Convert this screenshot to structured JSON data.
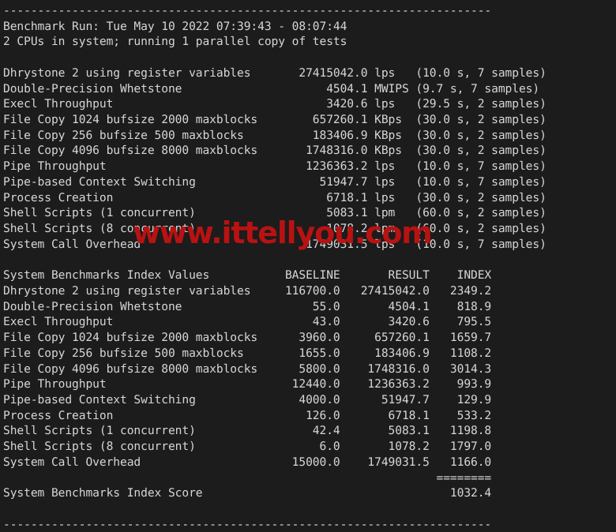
{
  "terminal": {
    "background_color": "#1c1c1c",
    "text_color": "#d6d6d6",
    "separator_line": "-----------------------------------------------------------------------",
    "header": {
      "benchmark_run": "Benchmark Run: Tue May 10 2022 07:39:43 - 08:07:44",
      "cpu_info": "2 CPUs in system; running 1 parallel copy of tests"
    },
    "results": {
      "rows": [
        {
          "name": "Dhrystone 2 using register variables",
          "value": "27415042.0",
          "unit": "lps",
          "detail": "(10.0 s, 7 samples)"
        },
        {
          "name": "Double-Precision Whetstone",
          "value": "4504.1",
          "unit": "MWIPS",
          "detail": "(9.7 s, 7 samples)"
        },
        {
          "name": "Execl Throughput",
          "value": "3420.6",
          "unit": "lps",
          "detail": "(29.5 s, 2 samples)"
        },
        {
          "name": "File Copy 1024 bufsize 2000 maxblocks",
          "value": "657260.1",
          "unit": "KBps",
          "detail": "(30.0 s, 2 samples)"
        },
        {
          "name": "File Copy 256 bufsize 500 maxblocks",
          "value": "183406.9",
          "unit": "KBps",
          "detail": "(30.0 s, 2 samples)"
        },
        {
          "name": "File Copy 4096 bufsize 8000 maxblocks",
          "value": "1748316.0",
          "unit": "KBps",
          "detail": "(30.0 s, 2 samples)"
        },
        {
          "name": "Pipe Throughput",
          "value": "1236363.2",
          "unit": "lps",
          "detail": "(10.0 s, 7 samples)"
        },
        {
          "name": "Pipe-based Context Switching",
          "value": "51947.7",
          "unit": "lps",
          "detail": "(10.0 s, 7 samples)"
        },
        {
          "name": "Process Creation",
          "value": "6718.1",
          "unit": "lps",
          "detail": "(30.0 s, 2 samples)"
        },
        {
          "name": "Shell Scripts (1 concurrent)",
          "value": "5083.1",
          "unit": "lpm",
          "detail": "(60.0 s, 2 samples)"
        },
        {
          "name": "Shell Scripts (8 concurrent)",
          "value": "1078.2",
          "unit": "lpm",
          "detail": "(60.0 s, 2 samples)"
        },
        {
          "name": "System Call Overhead",
          "value": "1749031.5",
          "unit": "lps",
          "detail": "(10.0 s, 7 samples)"
        }
      ]
    },
    "index_table": {
      "title": "System Benchmarks Index Values",
      "columns": [
        "BASELINE",
        "RESULT",
        "INDEX"
      ],
      "rows": [
        {
          "name": "Dhrystone 2 using register variables",
          "baseline": "116700.0",
          "result": "27415042.0",
          "index": "2349.2"
        },
        {
          "name": "Double-Precision Whetstone",
          "baseline": "55.0",
          "result": "4504.1",
          "index": "818.9"
        },
        {
          "name": "Execl Throughput",
          "baseline": "43.0",
          "result": "3420.6",
          "index": "795.5"
        },
        {
          "name": "File Copy 1024 bufsize 2000 maxblocks",
          "baseline": "3960.0",
          "result": "657260.1",
          "index": "1659.7"
        },
        {
          "name": "File Copy 256 bufsize 500 maxblocks",
          "baseline": "1655.0",
          "result": "183406.9",
          "index": "1108.2"
        },
        {
          "name": "File Copy 4096 bufsize 8000 maxblocks",
          "baseline": "5800.0",
          "result": "1748316.0",
          "index": "3014.3"
        },
        {
          "name": "Pipe Throughput",
          "baseline": "12440.0",
          "result": "1236363.2",
          "index": "993.9"
        },
        {
          "name": "Pipe-based Context Switching",
          "baseline": "4000.0",
          "result": "51947.7",
          "index": "129.9"
        },
        {
          "name": "Process Creation",
          "baseline": "126.0",
          "result": "6718.1",
          "index": "533.2"
        },
        {
          "name": "Shell Scripts (1 concurrent)",
          "baseline": "42.4",
          "result": "5083.1",
          "index": "1198.8"
        },
        {
          "name": "Shell Scripts (8 concurrent)",
          "baseline": "6.0",
          "result": "1078.2",
          "index": "1797.0"
        },
        {
          "name": "System Call Overhead",
          "baseline": "15000.0",
          "result": "1749031.5",
          "index": "1166.0"
        }
      ],
      "score_rule": "========",
      "score_label": "System Benchmarks Index Score",
      "score_value": "1032.4"
    }
  },
  "watermark": {
    "text": "www.ittellyou.com",
    "color": "#b81212"
  }
}
